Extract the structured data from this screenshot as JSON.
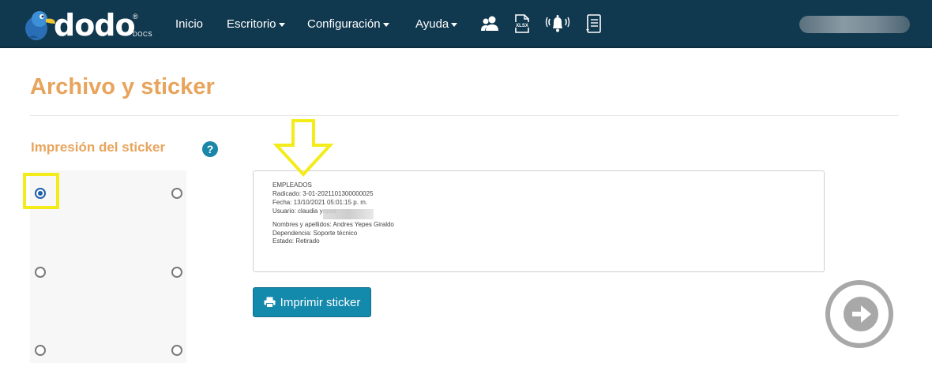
{
  "header": {
    "logo_text": "dodo",
    "logo_reg": "®",
    "logo_sub": "DOCS",
    "nav": [
      {
        "label": "Inicio",
        "has_caret": false
      },
      {
        "label": "Escritorio",
        "has_caret": true
      },
      {
        "label": "Configuración",
        "has_caret": true
      },
      {
        "label": "Ayuda",
        "has_caret": true
      }
    ],
    "icons": [
      "users-icon",
      "xlsx-file-icon",
      "bell-icon",
      "document-list-icon"
    ],
    "xlsx_label": "XLSX"
  },
  "page": {
    "title": "Archivo y sticker",
    "section_title": "Impresión del sticker",
    "help_label": "?"
  },
  "sticker_positions": {
    "options": [
      "top-left",
      "top-right",
      "middle-left",
      "middle-right",
      "bottom-left",
      "bottom-right"
    ],
    "selected": "top-left"
  },
  "preview": {
    "lines": [
      "EMPLEADOS",
      "Radicado: 3-01-2021101300000025",
      "Fecha: 13/10/2021 05:01:15 p. m.",
      "Usuario: claudia yepes",
      "",
      "Nombres y apellidos: Andres Yepes Giraldo",
      "Dependencia: Soporte técnico",
      "Estado: Retirado"
    ]
  },
  "actions": {
    "print_label": "Imprimir sticker"
  },
  "colors": {
    "navbar": "#10384e",
    "accent_orange": "#e8a45c",
    "button_blue": "#1389ac",
    "highlight_yellow": "#f4ec1a"
  }
}
